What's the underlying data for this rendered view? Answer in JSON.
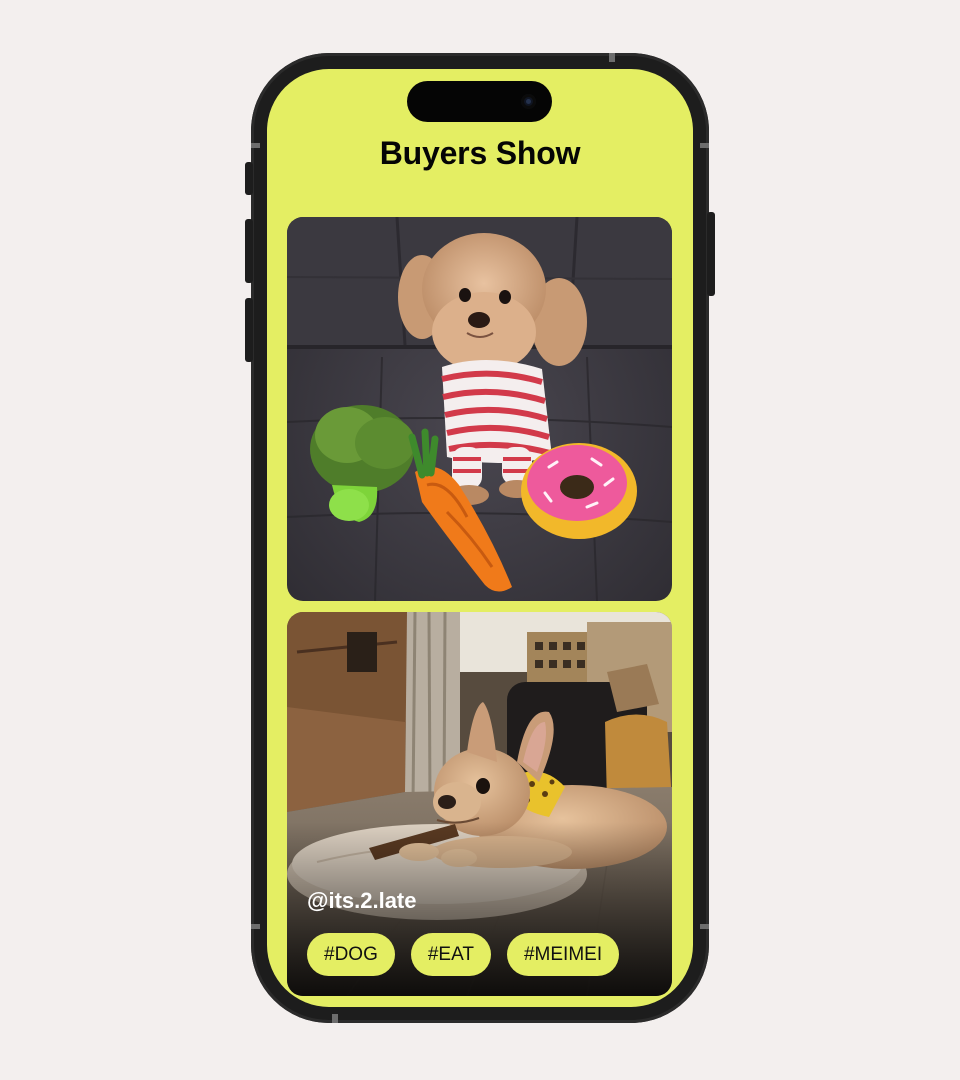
{
  "app": {
    "title": "Buyers Show"
  },
  "posts": [
    {
      "image": "poodle-with-toys-photo"
    },
    {
      "image": "french-bulldog-chewing-photo",
      "handle": "@its.2.late",
      "tags": [
        "#DOG",
        "#EAT",
        "#MEIMEI"
      ]
    }
  ],
  "colors": {
    "accent": "#e4ee63",
    "background": "#f3efee",
    "device_frame": "#1d1d1d"
  }
}
